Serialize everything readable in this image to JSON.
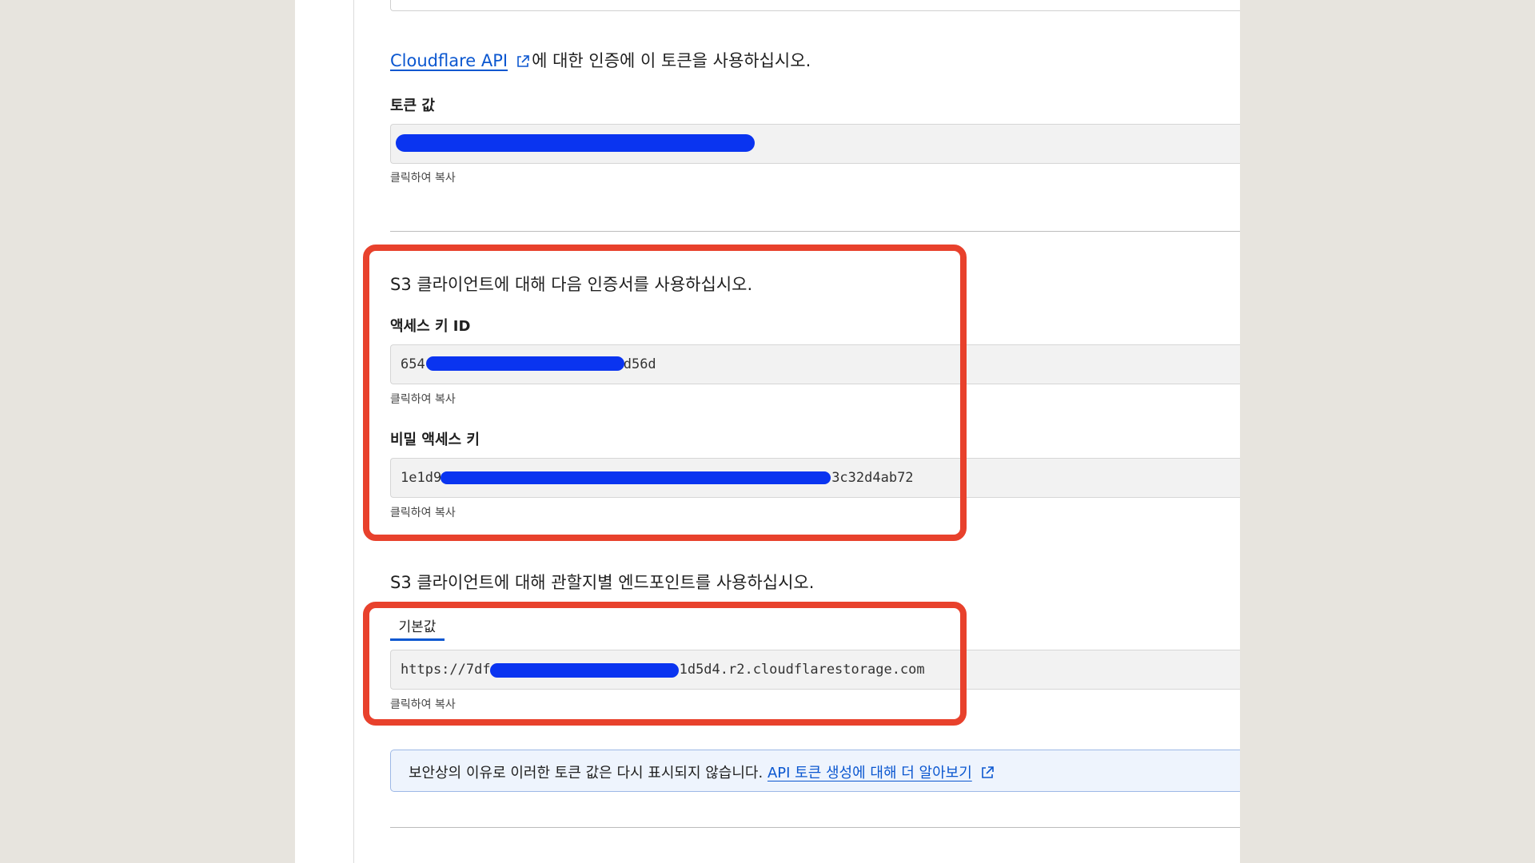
{
  "intro": {
    "link_label": "Cloudflare API",
    "text": "에 대한 인증에 이 토큰을 사용하십시오."
  },
  "token": {
    "label": "토큰 값",
    "value": "",
    "hint": "클릭하여 복사"
  },
  "s3_credentials": {
    "title": "S3 클라이언트에 대해 다음 인증서를 사용하십시오.",
    "access_key": {
      "label": "액세스 키 ID",
      "prefix": "654",
      "suffix": "d56d",
      "hint": "클릭하여 복사"
    },
    "secret_key": {
      "label": "비밀 액세스 키",
      "prefix": "1e1d9",
      "suffix": "3c32d4ab72",
      "hint": "클릭하여 복사"
    }
  },
  "endpoint": {
    "title": "S3 클라이언트에 대해 관할지별 엔드포인트를 사용하십시오.",
    "tab_label": "기본값",
    "prefix": "https://7df",
    "suffix": "1d5d4.r2.cloudflarestorage.com",
    "hint": "클릭하여 복사"
  },
  "notice": {
    "text": "보안상의 이유로 이러한 토큰 값은 다시 표시되지 않습니다.",
    "link_label": "API 토큰 생성에 대해 더 알아보기"
  },
  "colors": {
    "link": "#0b57d0",
    "redaction": "#0a34f0",
    "highlight": "#e8412c"
  },
  "icons": {
    "external_link": "external-link-icon"
  }
}
